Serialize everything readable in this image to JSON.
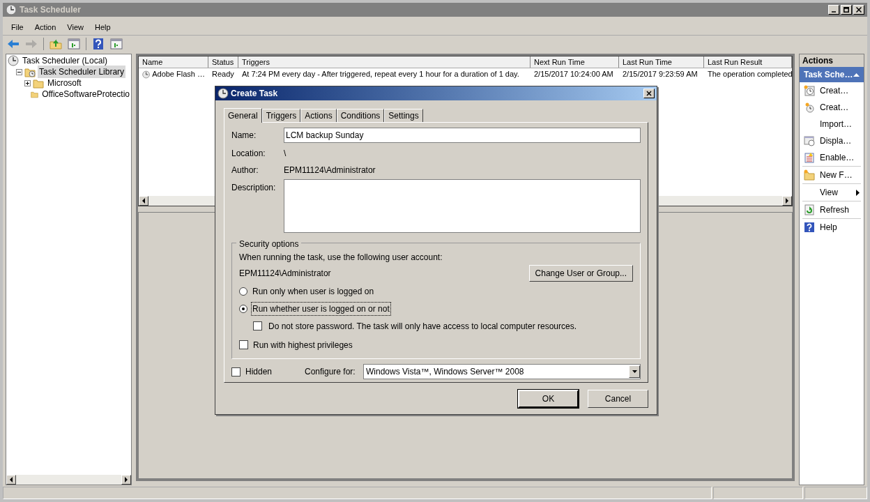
{
  "window": {
    "title": "Task Scheduler"
  },
  "menu": [
    "File",
    "Action",
    "View",
    "Help"
  ],
  "toolbar": [
    {
      "kind": "back",
      "disabled": false
    },
    {
      "kind": "forward",
      "disabled": true
    },
    {
      "kind": "sep"
    },
    {
      "kind": "up",
      "disabled": false
    },
    {
      "kind": "pane",
      "disabled": false
    },
    {
      "kind": "sep"
    },
    {
      "kind": "help",
      "disabled": false
    },
    {
      "kind": "pane2",
      "disabled": false
    }
  ],
  "tree": [
    {
      "label": "Task Scheduler (Local)",
      "kind": "computer",
      "selected": false,
      "children": [
        {
          "label": "Task Scheduler Library",
          "kind": "library",
          "selected": true,
          "expanded": true,
          "children": [
            {
              "label": "Microsoft",
              "kind": "folder",
              "selected": false,
              "expanded": false
            },
            {
              "label": "OfficeSoftwareProtectio",
              "kind": "folder",
              "selected": false
            }
          ]
        }
      ]
    }
  ],
  "table": {
    "columns": [
      "Name",
      "Status",
      "Triggers",
      "Next Run Time",
      "Last Run Time",
      "Last Run Result"
    ],
    "rows": [
      [
        "Adobe Flash …",
        "Ready",
        "At 7:24 PM every day - After triggered, repeat every 1 hour for a duration of 1 day.",
        "2/15/2017 10:24:00 AM",
        "2/15/2017 9:23:59 AM",
        "The operation completed"
      ]
    ]
  },
  "actions": {
    "title": "Actions",
    "group": "Task Sche…",
    "items": [
      {
        "kind": "create",
        "label": "Creat…"
      },
      {
        "kind": "basic",
        "label": "Creat…"
      },
      {
        "kind": "import",
        "label": "Import…"
      },
      {
        "kind": "display",
        "label": "Displa…"
      },
      {
        "kind": "enable",
        "label": "Enable…"
      },
      {
        "kind": "separator"
      },
      {
        "kind": "folder",
        "label": "New F…"
      },
      {
        "kind": "separator"
      },
      {
        "kind": "submenu",
        "label": "View"
      },
      {
        "kind": "separator"
      },
      {
        "kind": "refresh",
        "label": "Refresh"
      },
      {
        "kind": "separator"
      },
      {
        "kind": "help",
        "label": "Help"
      }
    ]
  },
  "dialog": {
    "title": "Create Task",
    "tabs": [
      {
        "label": "General",
        "selected": true
      },
      {
        "label": "Triggers",
        "selected": false
      },
      {
        "label": "Actions",
        "selected": false
      },
      {
        "label": "Conditions",
        "selected": false
      },
      {
        "label": "Settings",
        "selected": false
      }
    ],
    "name_label": "Name:",
    "name_value": "LCM backup Sunday",
    "location_label": "Location:",
    "location_value": "\\",
    "author_label": "Author:",
    "author_value": "EPM11124\\Administrator",
    "description_label": "Description:",
    "security": {
      "title": "Security options",
      "account_prompt": "When running the task, use the following user account:",
      "account": "EPM11124\\Administrator",
      "change_button": "Change User or Group...",
      "radios": [
        {
          "label": "Run only when user is logged on",
          "selected": false
        },
        {
          "label": "Run whether user is logged on or not",
          "selected": true
        }
      ],
      "store_password": {
        "label": "Do not store password.  The task will only have access to local computer resources.",
        "checked": false
      },
      "highest": {
        "label": "Run with highest privileges",
        "checked": false
      }
    },
    "hidden": {
      "label": "Hidden",
      "checked": false
    },
    "configure_label": "Configure for:",
    "configure_value": "Windows Vista™, Windows Server™ 2008",
    "buttons": [
      "OK",
      "Cancel"
    ]
  }
}
